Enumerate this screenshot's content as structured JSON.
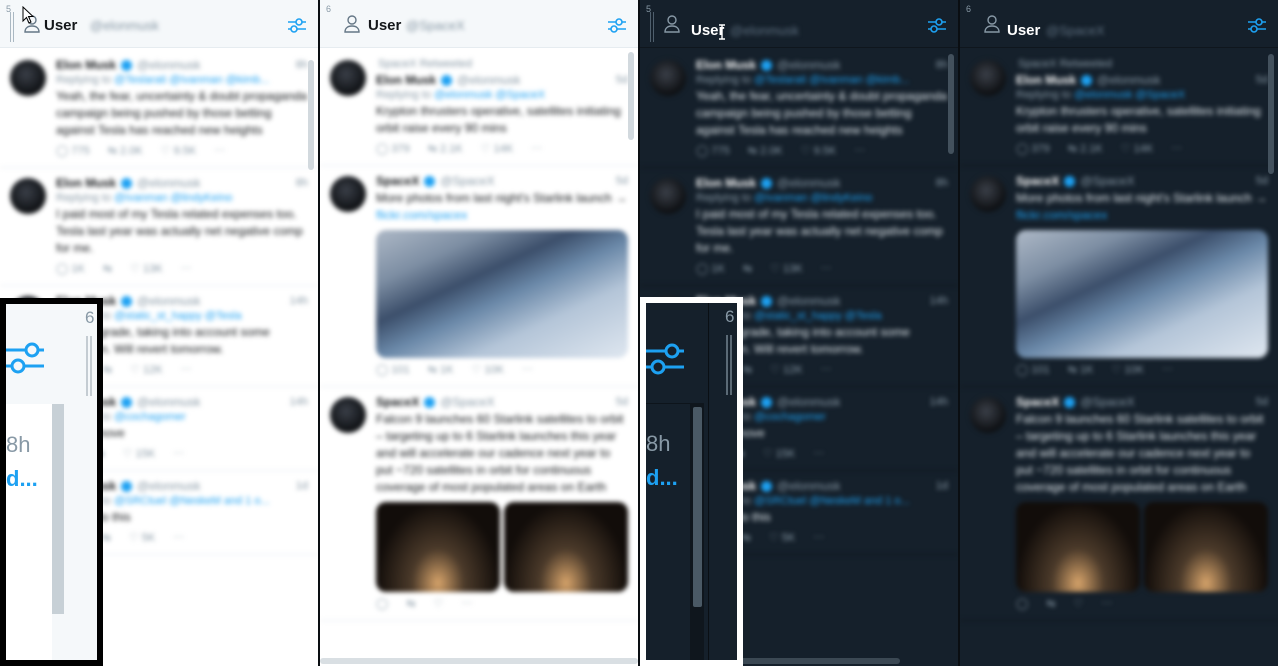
{
  "colors": {
    "accent": "#1da1f2",
    "light_bg": "#ffffff",
    "light_header": "#f5f8fa",
    "dark_bg": "#15202b"
  },
  "icons": {
    "column": "user-icon",
    "settings": "filter-sliders-icon",
    "verified": "verified-badge-icon",
    "reply": "reply-icon",
    "retweet": "retweet-icon",
    "like": "heart-icon",
    "more": "more-icon"
  },
  "panels": [
    {
      "theme": "light",
      "column": {
        "number": "5",
        "title": "User",
        "handle": "@elonmusk"
      },
      "tweets": [
        {
          "name": "Elon Musk",
          "handle": "@elonmusk",
          "time": "8h",
          "reply_to": "@Teslarati @Ivanman @kimb...",
          "text": "Yeah, the fear, uncertainty & doubt propaganda campaign being pushed by those betting against Tesla has reached new heights",
          "reply": "775",
          "retweet": "2.0K",
          "like": "9.5K"
        },
        {
          "name": "Elon Musk",
          "handle": "@elonmusk",
          "time": "8h",
          "reply_to": "@Ivanman @lindyKeino",
          "text": "I paid most of my Tesla related expenses too. Tesla last year was actually net negative comp for me.",
          "reply": "1K",
          "retweet": "",
          "like": "13K"
        },
        {
          "name": "Elon Musk",
          "handle": "@elonmusk",
          "time": "14h",
          "reply_to": "@static_st_happy @Tesla",
          "text": "Today's grade, taking into account some confusion. Will revert tomorrow.",
          "reply": "1K",
          "retweet": "",
          "like": "12K"
        },
        {
          "name": "Elon Musk",
          "handle": "@elonmusk",
          "time": "14h",
          "reply_to": "@cochagomer",
          "text": "Gonna move",
          "reply": "1",
          "retweet": "",
          "like": "15K"
        },
        {
          "name": "Elon Musk",
          "handle": "@elonmusk",
          "time": "1d",
          "reply_to": "@SRCtuel @NeskeM and 1 o...",
          "text": "Gonna do this",
          "reply": "30",
          "retweet": "",
          "like": "5K"
        }
      ]
    },
    {
      "theme": "light",
      "column": {
        "number": "6",
        "title": "User",
        "handle": "@SpaceX"
      },
      "tweets": [
        {
          "retweeted_by": "SpaceX Retweeted",
          "name": "Elon Musk",
          "handle": "@elonmusk",
          "time": "5d",
          "reply_to": "@elonmusk @SpaceX",
          "text": "Krypton thrusters operative, satellites initiating orbit raise every 90 mins",
          "reply": "379",
          "retweet": "2.1K",
          "like": "14K"
        },
        {
          "name": "SpaceX",
          "handle": "@SpaceX",
          "time": "5d",
          "text": "More photos from last night's Starlink launch →",
          "link": "flickr.com/spacex",
          "photo": "single",
          "reply": "101",
          "retweet": "1K",
          "like": "10K"
        },
        {
          "name": "SpaceX",
          "handle": "@SpaceX",
          "time": "5d",
          "text": "Falcon 9 launches 60 Starlink satellites to orbit – targeting up to 6 Starlink launches this year and will accelerate our cadence next year to put ~720 satellites in orbit for continuous coverage of most populated areas on Earth",
          "photo": "double",
          "reply": "",
          "retweet": "",
          "like": ""
        }
      ]
    },
    {
      "theme": "dark",
      "column": {
        "number": "5",
        "title": "User",
        "handle": "@elonmusk"
      },
      "tweets": [
        {
          "name": "Elon Musk",
          "handle": "@elonmusk",
          "time": "8h",
          "reply_to": "@Teslarati @Ivanman @kimb...",
          "text": "Yeah, the fear, uncertainty & doubt propaganda campaign being pushed by those betting against Tesla has reached new heights",
          "reply": "775",
          "retweet": "2.0K",
          "like": "9.5K"
        },
        {
          "name": "Elon Musk",
          "handle": "@elonmusk",
          "time": "8h",
          "reply_to": "@Ivanman @lindyKeino",
          "text": "I paid most of my Tesla related expenses too. Tesla last year was actually net negative comp for me.",
          "reply": "1K",
          "retweet": "",
          "like": "13K"
        },
        {
          "name": "Elon Musk",
          "handle": "@elonmusk",
          "time": "14h",
          "reply_to": "@static_st_happy @Tesla",
          "text": "Today's grade, taking into account some confusion. Will revert tomorrow.",
          "reply": "1K",
          "retweet": "",
          "like": "12K"
        },
        {
          "name": "Elon Musk",
          "handle": "@elonmusk",
          "time": "14h",
          "reply_to": "@cochagomer",
          "text": "Gonna move",
          "reply": "1",
          "retweet": "",
          "like": "15K"
        },
        {
          "name": "Elon Musk",
          "handle": "@elonmusk",
          "time": "1d",
          "reply_to": "@SRCtuel @NeskeM and 1 o...",
          "text": "Gonna do this",
          "reply": "30",
          "retweet": "",
          "like": "5K"
        }
      ]
    },
    {
      "theme": "dark",
      "column": {
        "number": "6",
        "title": "User",
        "handle": "@SpaceX"
      },
      "tweets": [
        {
          "retweeted_by": "SpaceX Retweeted",
          "name": "Elon Musk",
          "handle": "@elonmusk",
          "time": "5d",
          "reply_to": "@elonmusk @SpaceX",
          "text": "Krypton thrusters operative, satellites initiating orbit raise every 90 mins",
          "reply": "379",
          "retweet": "2.1K",
          "like": "14K"
        },
        {
          "name": "SpaceX",
          "handle": "@SpaceX",
          "time": "5d",
          "text": "More photos from last night's Starlink launch →",
          "link": "flickr.com/spacex",
          "photo": "single",
          "reply": "101",
          "retweet": "1K",
          "like": "10K"
        },
        {
          "name": "SpaceX",
          "handle": "@SpaceX",
          "time": "5d",
          "text": "Falcon 9 launches 60 Starlink satellites to orbit – targeting up to 6 Starlink launches this year and will accelerate our cadence next year to put ~720 satellites in orbit for continuous coverage of most populated areas on Earth",
          "photo": "double",
          "reply": "",
          "retweet": "",
          "like": ""
        }
      ]
    }
  ],
  "zooms": [
    {
      "theme": "light",
      "column_number": "6",
      "time": "8h",
      "link_fragment": "d..."
    },
    {
      "theme": "dark",
      "column_number": "6",
      "time": "8h",
      "link_fragment": "d..."
    }
  ]
}
